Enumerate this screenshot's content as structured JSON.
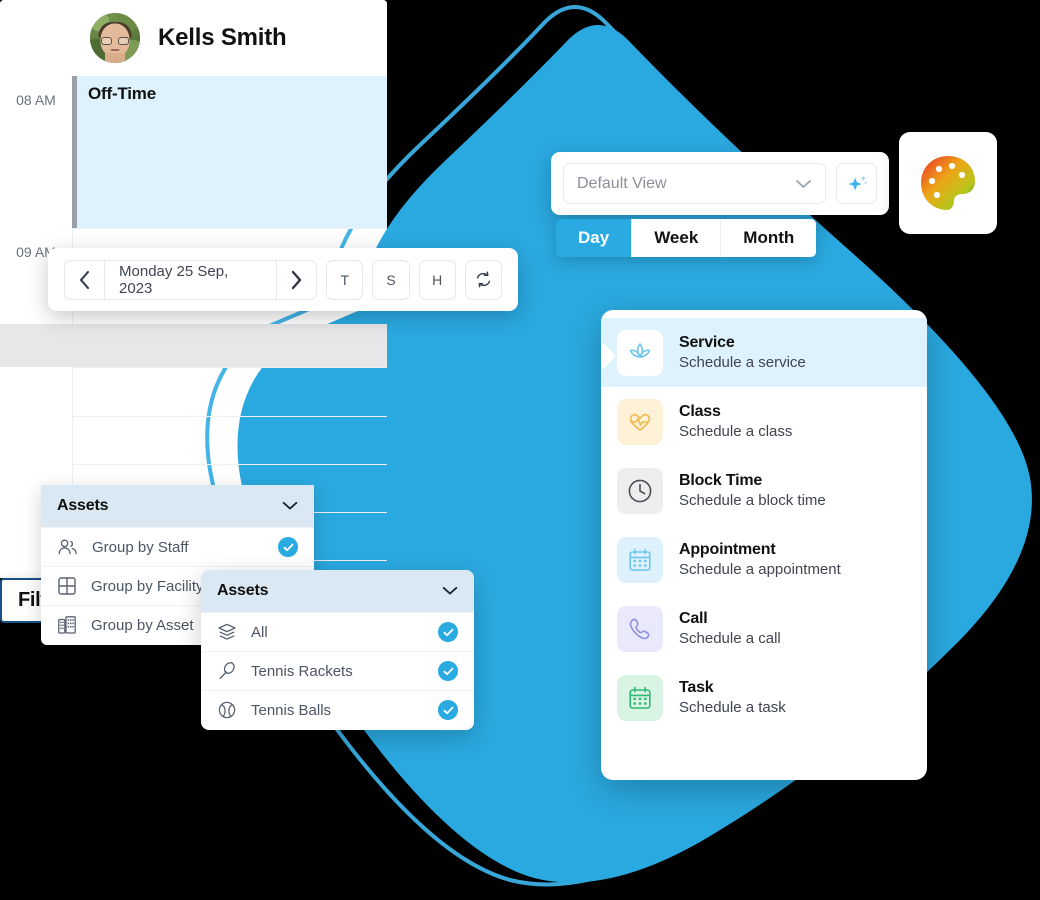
{
  "theme": {
    "accent": "#29abe2",
    "accent_light": "#ddf2fc",
    "panel_head": "#d9e8f3",
    "blob": "#2aa9e0",
    "focus_border": "#1b4f8a",
    "offtime_bar": "#9aa0a6"
  },
  "calendar": {
    "staff_name": "Kells Smith",
    "avatar_icon": "user-photo-avatar",
    "event": {
      "title": "Off-Time"
    },
    "time_labels": [
      "08 AM",
      "09 AM"
    ]
  },
  "date_nav": {
    "prev_icon": "chevron-left-icon",
    "next_icon": "chevron-right-icon",
    "date_label": "Monday 25 Sep, 2023",
    "buttons": [
      {
        "label": "T",
        "name": "today-button"
      },
      {
        "label": "S",
        "name": "shift-button"
      },
      {
        "label": "H",
        "name": "holiday-button"
      }
    ],
    "refresh_icon": "refresh-icon"
  },
  "view_bar": {
    "select_value": "Default View",
    "chevron_icon": "chevron-down-icon",
    "sparkle_icon": "sparkle-star-icon"
  },
  "segments": [
    {
      "label": "Day",
      "active": true
    },
    {
      "label": "Week",
      "active": false
    },
    {
      "label": "Month",
      "active": false
    }
  ],
  "palette": {
    "icon": "color-palette-icon"
  },
  "schedule_menu": {
    "items": [
      {
        "title": "Service",
        "subtitle": "Schedule a service",
        "icon": "lotus-flower-icon",
        "icon_bg": "#ffffff",
        "icon_color": "#6cc6ee",
        "selected": true
      },
      {
        "title": "Class",
        "subtitle": "Schedule a class",
        "icon": "heartbeat-icon",
        "icon_bg": "#fdf1d8",
        "icon_color": "#f5c45e",
        "selected": false
      },
      {
        "title": "Block Time",
        "subtitle": "Schedule a block time",
        "icon": "clock-icon",
        "icon_bg": "#ededee",
        "icon_color": "#4a4f57",
        "selected": false
      },
      {
        "title": "Appointment",
        "subtitle": "Schedule a appointment",
        "icon": "calendar-icon",
        "icon_bg": "#ddf2fc",
        "icon_color": "#6cc6ee",
        "selected": false
      },
      {
        "title": "Call",
        "subtitle": "Schedule a call",
        "icon": "phone-icon",
        "icon_bg": "#e9e9fb",
        "icon_color": "#8f8fe0",
        "selected": false
      },
      {
        "title": "Task",
        "subtitle": "Schedule a task",
        "icon": "calendar-check-icon",
        "icon_bg": "#d9f4e3",
        "icon_color": "#2eb872",
        "selected": false
      }
    ]
  },
  "filters": {
    "title": "Filters",
    "collapse_icon": "collapse-left-icon"
  },
  "group_panel": {
    "header": "Assets",
    "chevron_icon": "chevron-down-icon",
    "options": [
      {
        "label": "Group by Staff",
        "icon": "users-icon",
        "checked": true
      },
      {
        "label": "Group by Facility",
        "icon": "grid-icon",
        "checked": false
      },
      {
        "label": "Group by Asset",
        "icon": "building-icon",
        "checked": false
      }
    ]
  },
  "assets_panel": {
    "header": "Assets",
    "chevron_icon": "chevron-down-icon",
    "options": [
      {
        "label": "All",
        "icon": "layers-icon",
        "checked": true
      },
      {
        "label": "Tennis Rackets",
        "icon": "tennis-racket-icon",
        "checked": true
      },
      {
        "label": "Tennis Balls",
        "icon": "tennis-ball-icon",
        "checked": true
      }
    ]
  }
}
